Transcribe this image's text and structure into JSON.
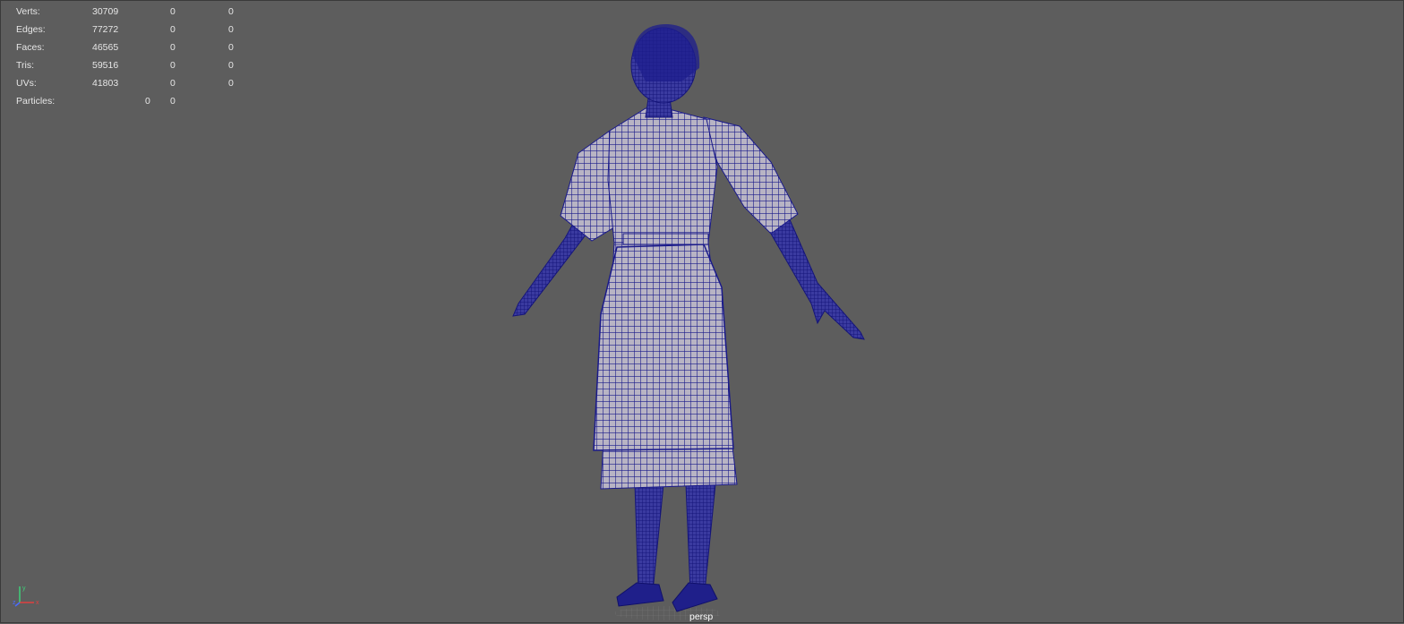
{
  "viewport": {
    "camera": "persp",
    "background_color": "#5d5d5d",
    "wireframe_color": "#1a1a8a",
    "heads_up_display": {
      "rows": [
        {
          "label": "Verts:",
          "total": "30709",
          "selected": "0",
          "component": "0"
        },
        {
          "label": "Edges:",
          "total": "77272",
          "selected": "0",
          "component": "0"
        },
        {
          "label": "Faces:",
          "total": "46565",
          "selected": "0",
          "component": "0"
        },
        {
          "label": "Tris:",
          "total": "59516",
          "selected": "0",
          "component": "0"
        },
        {
          "label": "UVs:",
          "total": "41803",
          "selected": "0",
          "component": "0"
        }
      ],
      "particles": {
        "label": "Particles:",
        "a": "0",
        "b": "0"
      }
    },
    "model": {
      "icon": "wireframe-character-model"
    },
    "axis_gizmo": {
      "x": "x",
      "y": "y",
      "z": "z"
    }
  }
}
